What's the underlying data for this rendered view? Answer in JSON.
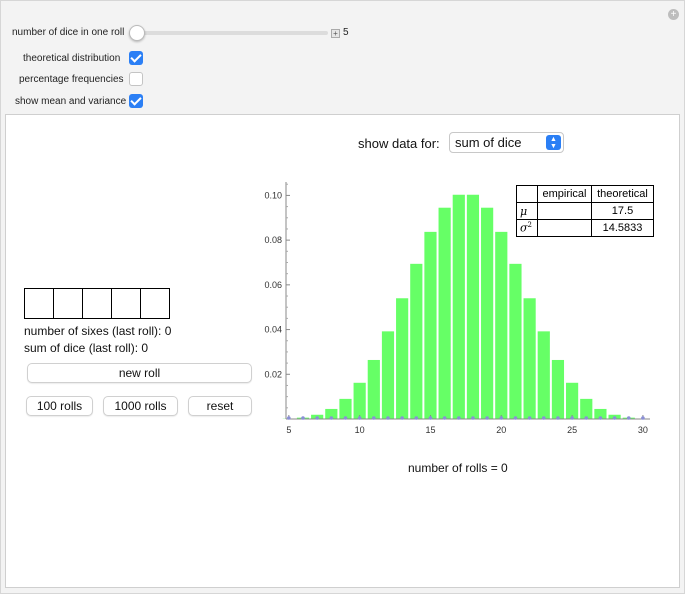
{
  "controls": {
    "dice_label": "number of dice in one roll",
    "dice_value": "5",
    "theoretical_label": "theoretical distribution",
    "theoretical_checked": true,
    "percentage_label": "percentage frequencies",
    "percentage_checked": false,
    "meanvar_label": "show mean and variance",
    "meanvar_checked": true
  },
  "show_data": {
    "label": "show data for:",
    "selected": "sum of dice"
  },
  "dice_faces": [
    "",
    "",
    "",
    "",
    ""
  ],
  "info": {
    "sixes_line": "number of sixes (last roll): 0",
    "sum_line": "sum of dice (last roll): 0"
  },
  "buttons": {
    "new_roll": "new roll",
    "hundred": "100 rolls",
    "thousand": "1000 rolls",
    "reset": "reset"
  },
  "rolls_text": "number of rolls = 0",
  "stats_table": {
    "headers": [
      "",
      "empirical",
      "theoretical"
    ],
    "rows": [
      {
        "symbol": "μ",
        "empirical": "",
        "theoretical": "17.5"
      },
      {
        "symbol": "σ",
        "sup": "2",
        "empirical": "",
        "theoretical": "14.5833"
      }
    ]
  },
  "chart_data": {
    "type": "bar",
    "x": [
      5,
      6,
      7,
      8,
      9,
      10,
      11,
      12,
      13,
      14,
      15,
      16,
      17,
      18,
      19,
      20,
      21,
      22,
      23,
      24,
      25,
      26,
      27,
      28,
      29,
      30
    ],
    "values": [
      0.0001,
      0.0006,
      0.0019,
      0.0045,
      0.009,
      0.0162,
      0.0264,
      0.0392,
      0.054,
      0.0694,
      0.0837,
      0.0945,
      0.1003,
      0.1003,
      0.0945,
      0.0837,
      0.0694,
      0.054,
      0.0392,
      0.0264,
      0.0162,
      0.009,
      0.0045,
      0.0019,
      0.0006,
      0.0001
    ],
    "empirical_values": [
      0,
      0,
      0,
      0,
      0,
      0,
      0,
      0,
      0,
      0,
      0,
      0,
      0,
      0,
      0,
      0,
      0,
      0,
      0,
      0,
      0,
      0,
      0,
      0,
      0,
      0
    ],
    "xticks": [
      5,
      10,
      15,
      20,
      25,
      30
    ],
    "yticks": [
      0.02,
      0.04,
      0.06,
      0.08,
      0.1
    ],
    "ytick_labels": [
      "0.02",
      "0.04",
      "0.06",
      "0.08",
      "0.10"
    ],
    "xlim": [
      4.8,
      30.5
    ],
    "ylim": [
      0,
      0.106
    ],
    "bar_color": "#66ff66",
    "point_color": "#8a8fd6"
  }
}
